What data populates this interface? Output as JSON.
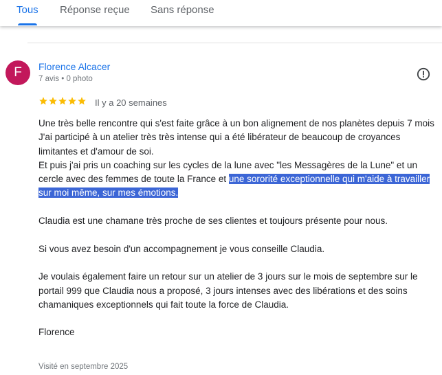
{
  "tabs": [
    {
      "label": "Tous",
      "active": true
    },
    {
      "label": "Réponse reçue",
      "active": false
    },
    {
      "label": "Sans réponse",
      "active": false
    }
  ],
  "review": {
    "avatar_letter": "F",
    "avatar_color": "#c2185b",
    "reviewer_name": "Florence Alcacer",
    "reviewer_meta": "7 avis • 0 photo",
    "rating": 5,
    "rating_max": 5,
    "date": "Il y a 20 semaines",
    "text": {
      "p1_l1": "Une très belle rencontre qui s'est faite grâce à un bon alignement de nos planètes depuis 7 mois",
      "p1_l2": "J'ai participé à un atelier très très intense qui a été libérateur de beaucoup de croyances limitantes et d'amour de soi.",
      "p1_l3_before": "Et puis j'ai pris un coaching sur les cycles de la lune avec \"les Messagères de la Lune\" et un cercle avec des femmes de toute la France et ",
      "p1_l3_highlight": "une sororité exceptionnelle qui m'aide à travailler sur moi même, sur mes émotions.",
      "p2": "Claudia est une chamane très proche de ses clientes et toujours présente pour nous.",
      "p3": "Si vous avez besoin d'un accompagnement je vous conseille Claudia.",
      "p4": "Je voulais également faire un retour sur un atelier de 3 jours sur le mois de septembre sur le portail 999 que Claudia nous a proposé, 3 jours intenses avec des libérations et des soins chamaniques exceptionnels qui fait toute la force de Claudia.",
      "p5": "Florence"
    },
    "visited": "Visité en septembre 2025"
  },
  "colors": {
    "accent": "#1a73e8",
    "star": "#fbbc04",
    "highlight": "#3c66d6"
  },
  "icons": {
    "flag": "report-flag-icon",
    "star": "star-icon"
  }
}
